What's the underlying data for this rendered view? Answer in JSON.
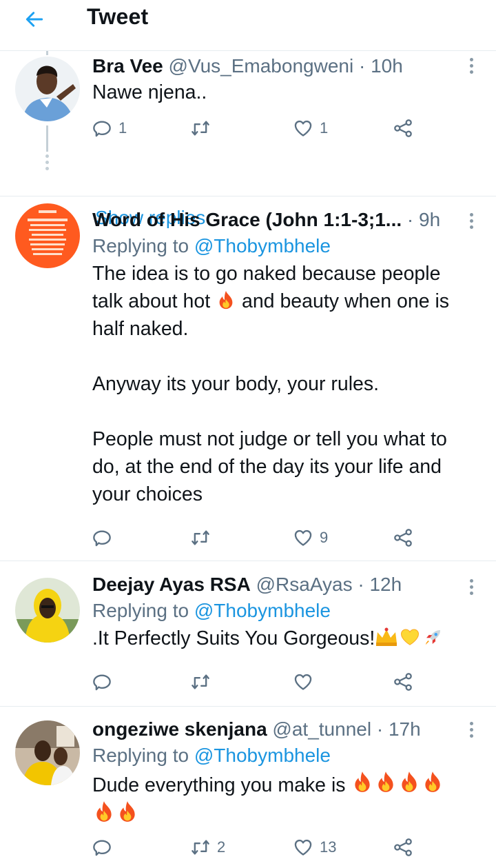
{
  "header": {
    "title": "Tweet"
  },
  "tweets": [
    {
      "name": "Bra Vee",
      "handle": "@Vus_Emabongweni",
      "time": "· 10h",
      "text": "Nawe njena..",
      "reply_count": "1",
      "retweet_count": "",
      "like_count": "1",
      "show_replies": "Show replies"
    },
    {
      "name": "Word of His Grace (John 1:1-3;1...",
      "handle": "",
      "time": "· 9h",
      "replying_prefix": "Replying to",
      "replying_to": "@Thobymbhele",
      "text_1": "The idea is to go naked because people talk about hot",
      "text_2": "and beauty when one is half naked.\n\nAnyway its your body, your rules.\n\nPeople must not judge or tell you what to do, at the end of the day its your life and your choices",
      "reply_count": "",
      "retweet_count": "",
      "like_count": "9"
    },
    {
      "name": "Deejay Ayas RSA",
      "handle": "@RsaAyas",
      "time": "· 12h",
      "replying_prefix": "Replying to",
      "replying_to": "@Thobymbhele",
      "text": ".It Perfectly Suits You Gorgeous!",
      "reply_count": "",
      "retweet_count": "",
      "like_count": ""
    },
    {
      "name": "ongeziwe skenjana",
      "handle": "@at_tunnel",
      "time": "· 17h",
      "replying_prefix": "Replying to",
      "replying_to": "@Thobymbhele",
      "text": "Dude everything you make is",
      "reply_count": "",
      "retweet_count": "2",
      "like_count": "13"
    }
  ],
  "colors": {
    "accent": "#1b95e0",
    "muted": "#5b7083",
    "divider": "#e6ecf0",
    "fire": "#ff6a13"
  },
  "icons": [
    "back-arrow-icon",
    "more-vertical-icon",
    "reply-icon",
    "retweet-icon",
    "like-icon",
    "share-icon",
    "fire-emoji",
    "crown-emoji",
    "yellow-heart-emoji",
    "rocket-emoji"
  ]
}
